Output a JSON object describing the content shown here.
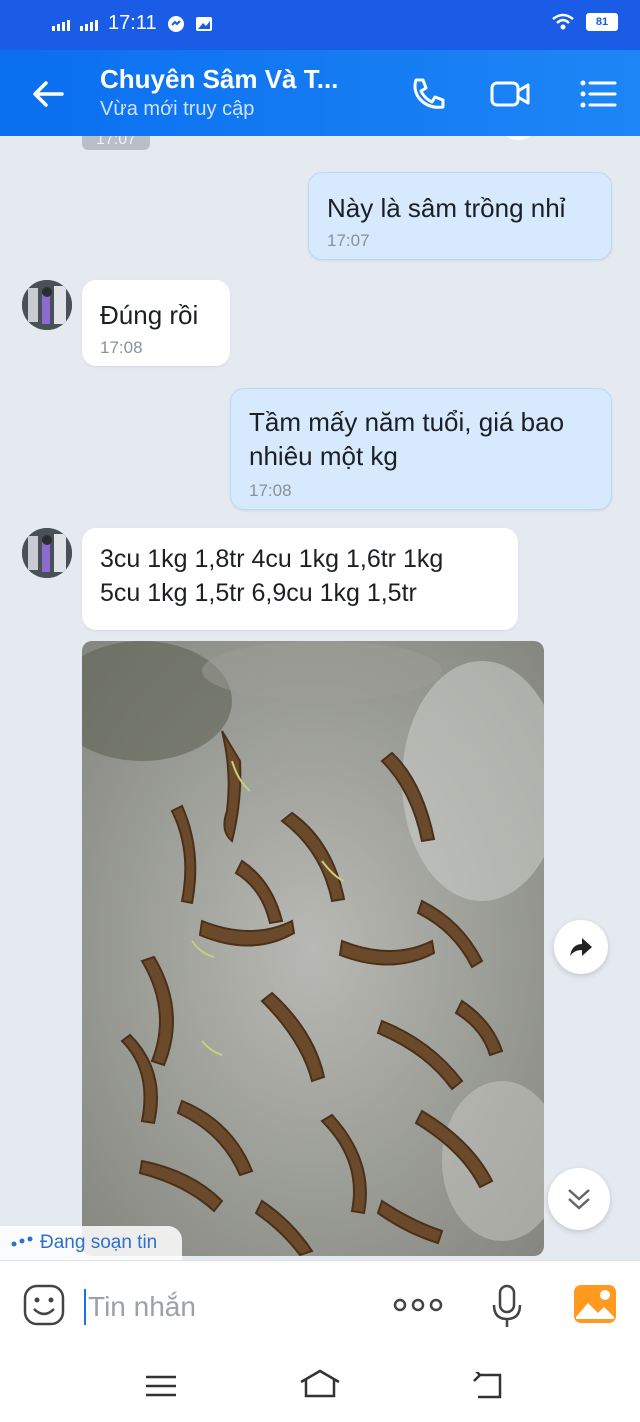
{
  "status_bar": {
    "time": "17:11",
    "battery": "81"
  },
  "header": {
    "title": "Chuyên Sâm Và T...",
    "subtitle": "Vừa mới truy cập"
  },
  "messages": {
    "top_timestamp": "17:07",
    "items": [
      {
        "direction": "sent",
        "text": "Này là sâm trồng nhỉ",
        "time": "17:07"
      },
      {
        "direction": "received",
        "text": "Đúng rồi",
        "time": "17:08"
      },
      {
        "direction": "sent",
        "text_line1": "Tầm mấy năm tuổi, giá bao",
        "text_line2": "nhiêu một kg",
        "time": "17:08"
      },
      {
        "direction": "received",
        "text_line1": "3cu 1kg  1,8tr 4cu 1kg 1,6tr 1kg",
        "text_line2": "5cu 1kg 1,5tr 6,9cu 1kg  1,5tr"
      }
    ]
  },
  "typing_indicator": "Đang soạn tin",
  "composer": {
    "placeholder": "Tin nhắn"
  },
  "colors": {
    "header": "#0a6ff0",
    "sent_bubble": "#d6e9fd",
    "background": "#e5e9f0"
  }
}
